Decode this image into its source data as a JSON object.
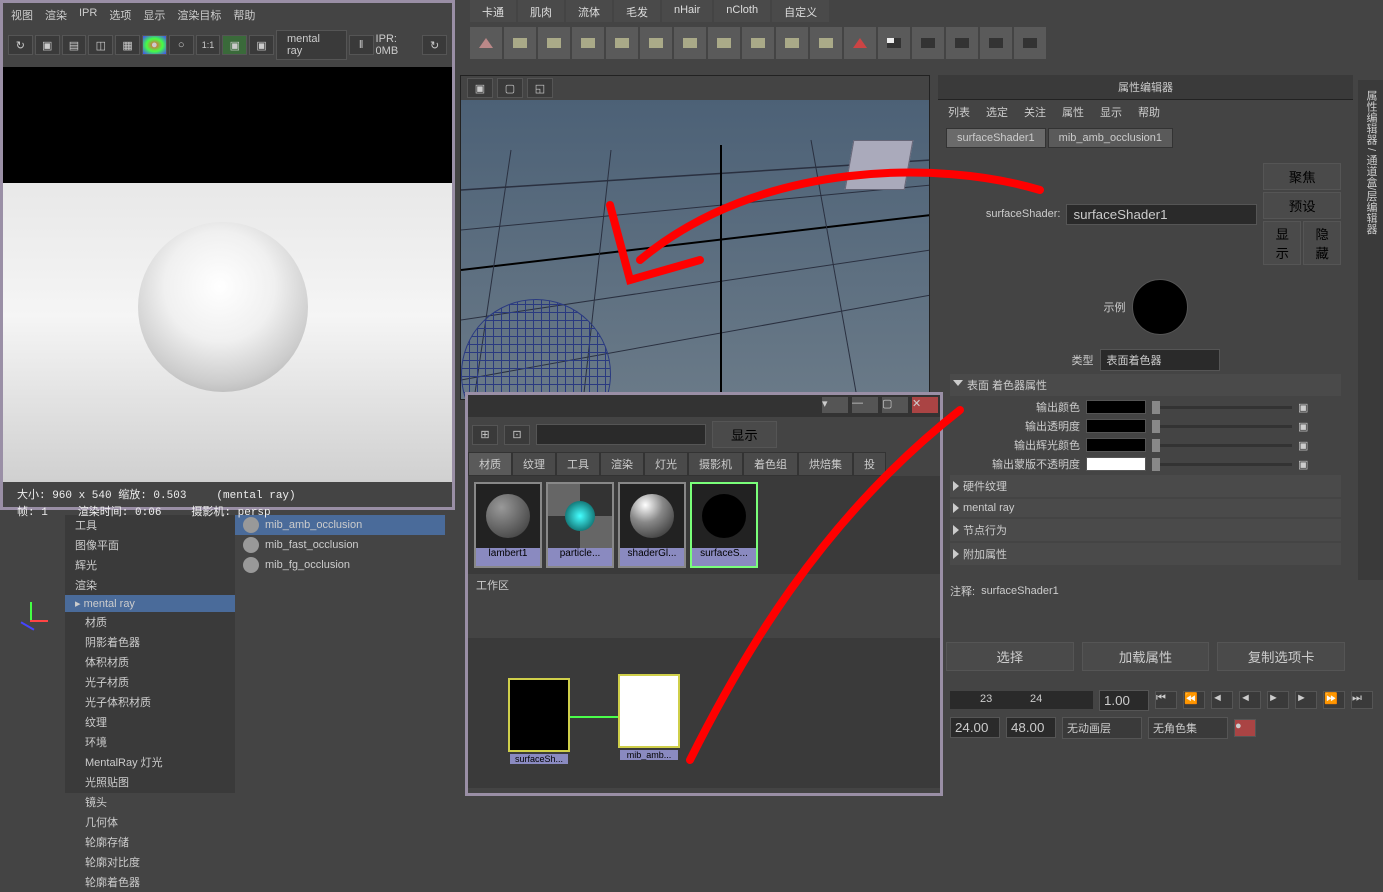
{
  "shelf": {
    "tabs": [
      "卡通",
      "肌肉",
      "流体",
      "毛发",
      "nHair",
      "nCloth",
      "自定义"
    ]
  },
  "render": {
    "menus": [
      "视图",
      "渲染",
      "IPR",
      "选项",
      "显示",
      "渲染目标",
      "帮助"
    ],
    "engine": "mental ray",
    "ipr_status": "IPR: 0MB",
    "size": "大小:  960 x 540  缩放:  0.503",
    "engine_label": "(mental ray)",
    "frame": "帧:  1",
    "time": "渲染时间:  0:06",
    "camera": "摄影机:  persp"
  },
  "attr": {
    "title": "属性编辑器",
    "menus": [
      "列表",
      "选定",
      "关注",
      "属性",
      "显示",
      "帮助"
    ],
    "tabs": [
      "surfaceShader1",
      "mib_amb_occlusion1"
    ],
    "type_label": "类型",
    "type_value": "表面着色器",
    "shader_label": "surfaceShader:",
    "shader_value": "surfaceShader1",
    "sample": "示例",
    "btns": {
      "focus": "聚焦",
      "preset": "预设",
      "show": "显示",
      "hide": "隐藏"
    },
    "section_main": "表面 着色器属性",
    "fields": {
      "out_color": "输出颜色",
      "out_trans": "输出透明度",
      "out_glow": "输出辉光颜色",
      "out_matte": "输出蒙版不透明度"
    },
    "sections": [
      "硬件纹理",
      "mental ray",
      "节点行为",
      "附加属性"
    ],
    "note_label": "注释:",
    "note_value": "surfaceShader1",
    "bottom": {
      "select": "选择",
      "load": "加载属性",
      "copy": "复制选项卡"
    }
  },
  "outliner": {
    "header": "工具",
    "items": [
      "图像平面",
      "辉光",
      "渲染",
      "mental ray",
      "材质",
      "阴影着色器",
      "体积材质",
      "光子材质",
      "光子体积材质",
      "纹理",
      "环境",
      "MentalRay 灯光",
      "光照贴图",
      "镜头",
      "几何体",
      "轮廓存储",
      "轮廓对比度",
      "轮廓着色器"
    ],
    "selected": "mental ray",
    "nodes": [
      "mib_amb_occlusion",
      "mib_fast_occlusion",
      "mib_fg_occlusion"
    ]
  },
  "hypershade": {
    "show_btn": "显示",
    "tabs": [
      "材质",
      "纹理",
      "工具",
      "渲染",
      "灯光",
      "摄影机",
      "着色组",
      "烘焙集",
      "投"
    ],
    "materials": [
      {
        "name": "lambert1"
      },
      {
        "name": "particle..."
      },
      {
        "name": "shaderGl..."
      },
      {
        "name": "surfaceS..."
      }
    ],
    "workarea": "工作区",
    "work_nodes": [
      "surfaceSh...",
      "mib_amb..."
    ]
  },
  "timeline": {
    "cur": "1.00",
    "start": "24.00",
    "end": "48.00",
    "marks": [
      "23",
      "24"
    ],
    "anim_layer": "无动画层",
    "char_set": "无角色集"
  }
}
